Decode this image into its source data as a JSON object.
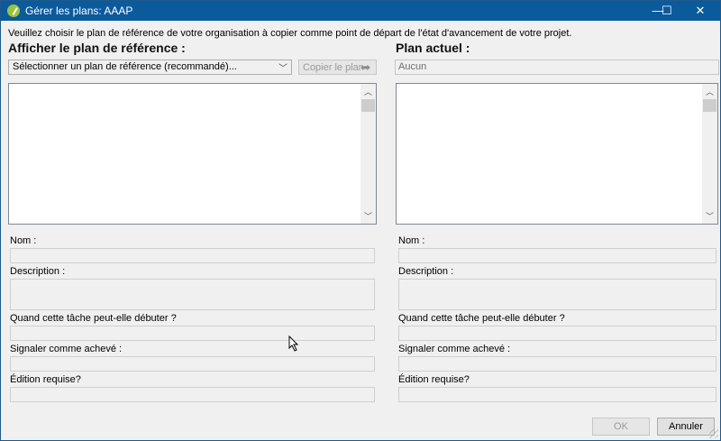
{
  "window": {
    "title": "Gérer les plans: AAAP",
    "minimize_glyph": "—",
    "maximize_glyph": "☐",
    "close_glyph": "✕"
  },
  "instructions": "Veuillez choisir le plan de référence de votre organisation à copier comme point de départ de l'état d'avancement de votre projet.",
  "left": {
    "title": "Afficher le plan de référence :",
    "combo_value": "Sélectionner un plan de référence (recommandé)...",
    "copy_button": "Copier le plan",
    "fields": {
      "nom": "Nom :",
      "description": "Description :",
      "quand": "Quand cette tâche peut-elle débuter ?",
      "signaler": "Signaler comme achevé :",
      "edition": "Édition requise?"
    }
  },
  "right": {
    "title": "Plan actuel :",
    "current_value": "Aucun",
    "fields": {
      "nom": "Nom :",
      "description": "Description :",
      "quand": "Quand cette tâche peut-elle débuter ?",
      "signaler": "Signaler comme achevé :",
      "edition": "Édition requise?"
    }
  },
  "buttons": {
    "ok": "OK",
    "cancel": "Annuler"
  },
  "icons": {
    "app": "app-logo-icon",
    "combo_dropdown": "chevron-down-icon",
    "copy_arrow": "arrow-right-icon",
    "scroll_up": "chevron-up-icon",
    "scroll_down": "chevron-down-icon"
  },
  "colors": {
    "titlebar": "#0b5a9c",
    "window_bg": "#f0f0f0"
  }
}
